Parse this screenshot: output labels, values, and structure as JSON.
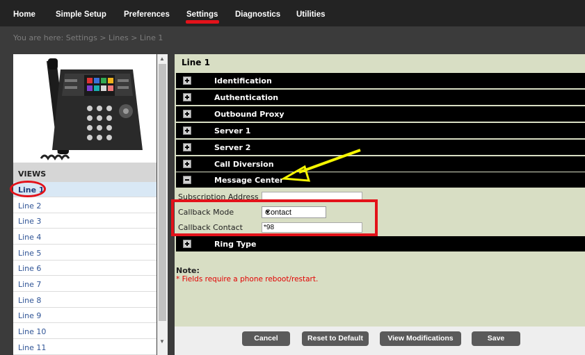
{
  "nav": {
    "items": [
      "Home",
      "Simple Setup",
      "Preferences",
      "Settings",
      "Diagnostics",
      "Utilities"
    ],
    "active": "Settings"
  },
  "breadcrumb": "You are here: Settings > Lines > Line 1",
  "sidebar": {
    "views_label": "VIEWS",
    "lines": [
      "Line 1",
      "Line 2",
      "Line 3",
      "Line 4",
      "Line 5",
      "Line 6",
      "Line 7",
      "Line 8",
      "Line 9",
      "Line 10",
      "Line 11"
    ],
    "active_line": "Line 1"
  },
  "content": {
    "title": "Line 1",
    "sections": {
      "identification": "Identification",
      "authentication": "Authentication",
      "outbound_proxy": "Outbound Proxy",
      "server1": "Server 1",
      "server2": "Server 2",
      "call_diversion": "Call Diversion",
      "message_center": "Message Center",
      "ring_type": "Ring Type"
    },
    "fields": {
      "subscription_address": {
        "label": "Subscription Address",
        "value": ""
      },
      "callback_mode": {
        "label": "Callback Mode",
        "value": "Contact"
      },
      "callback_contact": {
        "label": "Callback Contact",
        "value": "*98"
      }
    },
    "note_title": "Note:",
    "note_text": "* Fields require a phone reboot/restart."
  },
  "buttons": {
    "cancel": "Cancel",
    "reset": "Reset to Default",
    "view_mods": "View Modifications",
    "save": "Save"
  },
  "icons": {
    "expand": "plus-box-icon",
    "collapse": "minus-box-icon",
    "dropdown": "triangle-down-icon",
    "scroll_up": "triangle-up-icon",
    "scroll_down": "triangle-down-icon"
  },
  "colors": {
    "nav_bg": "#232323",
    "active_underline": "#e3121a",
    "content_bg": "#d8dec4",
    "section_bar": "#000000",
    "annotation_red": "#e3121a",
    "annotation_arrow": "#f5f500",
    "note_red": "#e20000"
  }
}
